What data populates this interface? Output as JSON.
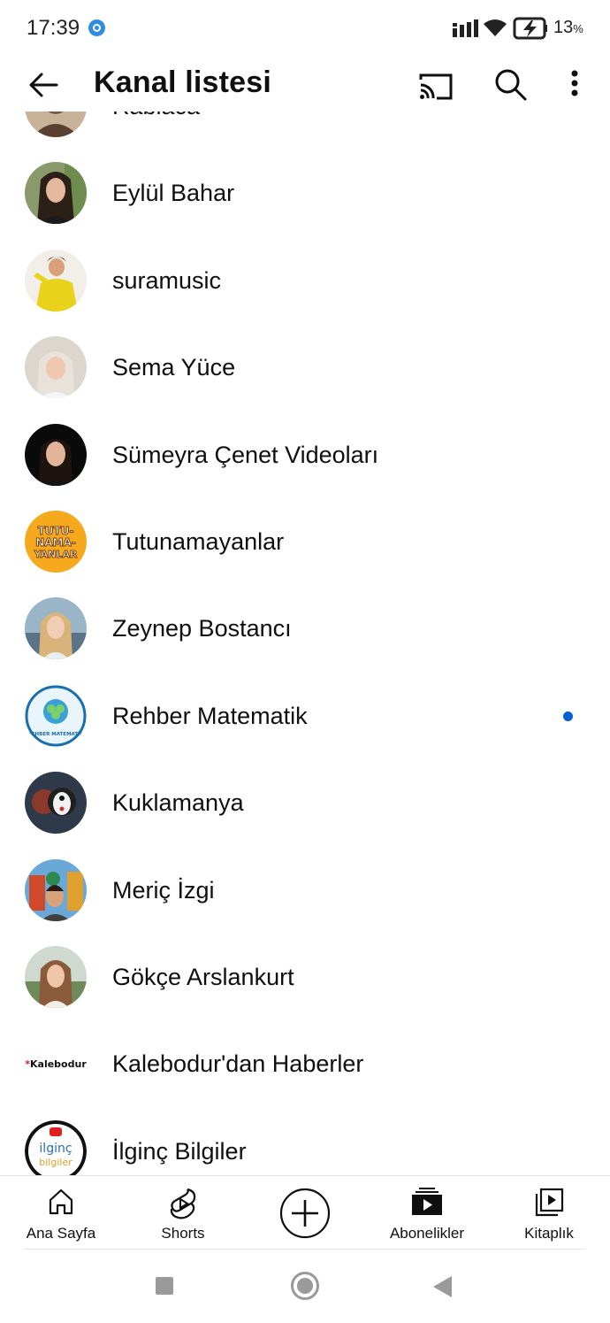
{
  "status_bar": {
    "time": "17:39",
    "battery_level": "13",
    "battery_unit": "%"
  },
  "header": {
    "title": "Kanal listesi",
    "icons": [
      "back-arrow-icon",
      "cast-icon",
      "search-icon",
      "more-vert-icon"
    ]
  },
  "channels": [
    {
      "name": "Rabiaca",
      "avatar": "person-photo"
    },
    {
      "name": "Eylül Bahar",
      "avatar": "person-photo"
    },
    {
      "name": "suramusic",
      "avatar": "person-photo"
    },
    {
      "name": "Sema Yüce",
      "avatar": "person-photo"
    },
    {
      "name": "Sümeyra Çenet Videoları",
      "avatar": "person-photo"
    },
    {
      "name": "Tutunamayanlar",
      "avatar": "logo",
      "logo_text": "TUTU-NAMA-YANLAR"
    },
    {
      "name": "Zeynep Bostancı",
      "avatar": "person-photo"
    },
    {
      "name": "Rehber Matematik",
      "avatar": "logo",
      "logo_text": "REHBER MATEMATİK",
      "has_new_content": true
    },
    {
      "name": "Kuklamanya",
      "avatar": "puppet-photo"
    },
    {
      "name": "Meriç İzgi",
      "avatar": "person-photo"
    },
    {
      "name": "Gökçe Arslankurt",
      "avatar": "person-photo"
    },
    {
      "name": "Kalebodur'dan Haberler",
      "avatar": "logo",
      "logo_text": "*Kalebodur"
    },
    {
      "name": "İlginç Bilgiler",
      "avatar": "logo",
      "logo_text": "ilginç bilgiler"
    }
  ],
  "bottom_nav": {
    "home": "Ana Sayfa",
    "shorts": "Shorts",
    "create": "create-plus-icon",
    "subscriptions": "Abonelikler",
    "library": "Kitaplık"
  },
  "colors": {
    "new_dot": "#065fd4",
    "text_primary": "#0f0f0f",
    "status_dot": "#2f8cde"
  }
}
